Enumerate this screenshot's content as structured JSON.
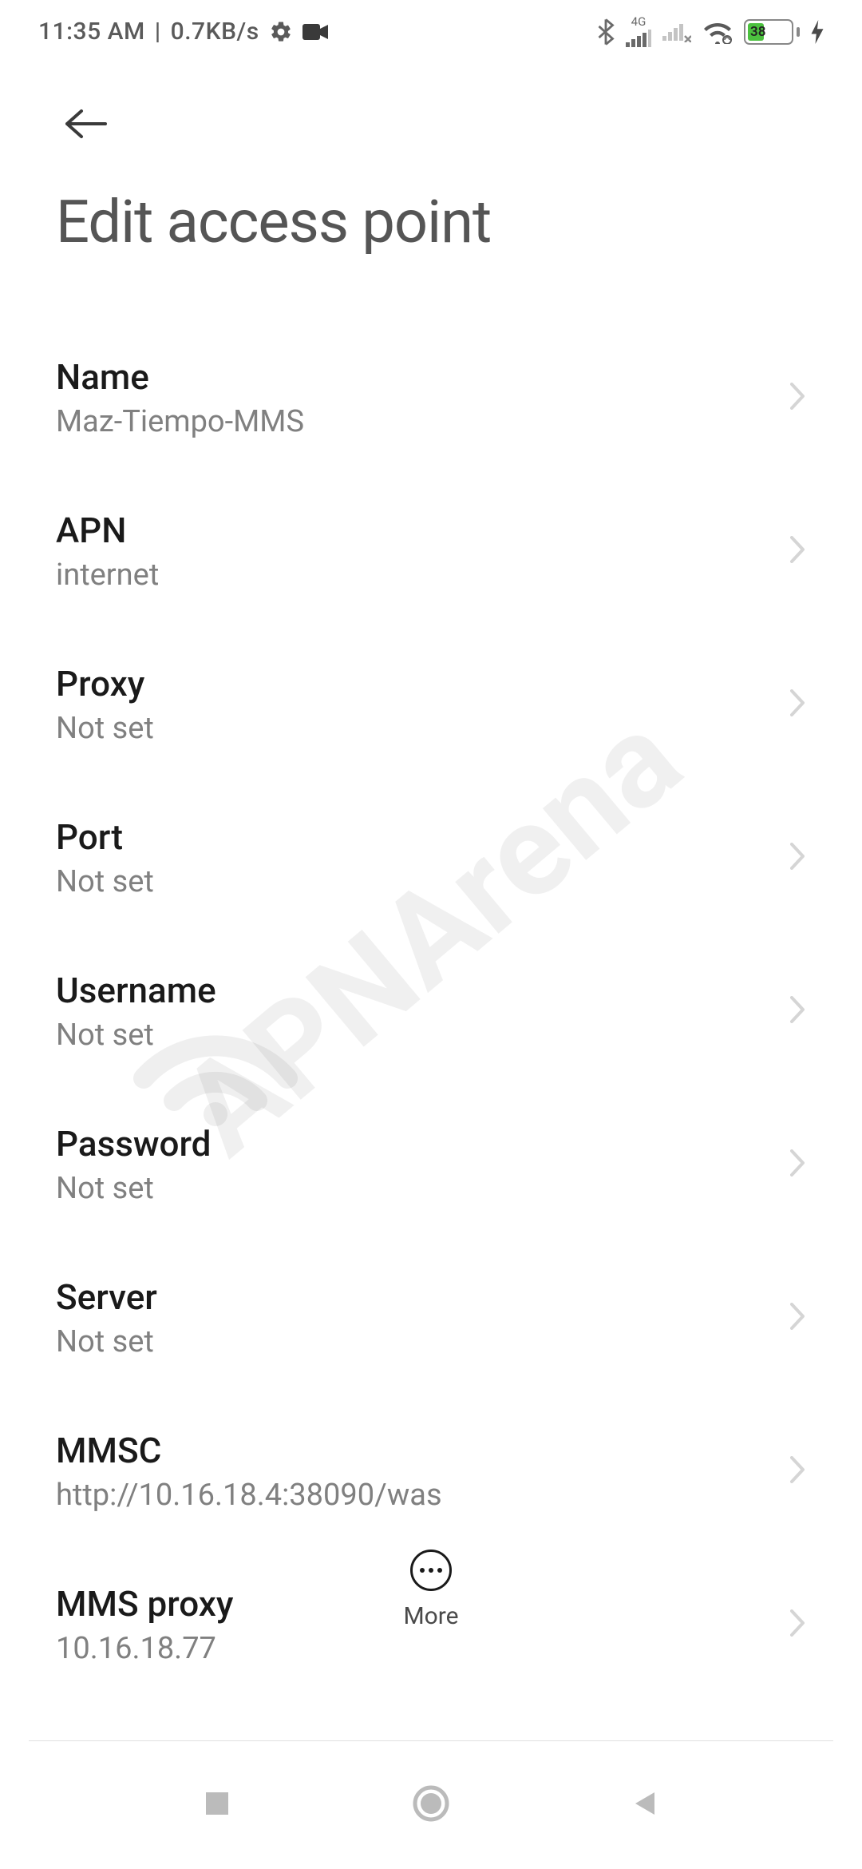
{
  "status": {
    "time": "11:35 AM",
    "sep": "|",
    "speed": "0.7KB/s",
    "network_label": "4G",
    "battery_pct": "38"
  },
  "header": {
    "title": "Edit access point"
  },
  "rows": [
    {
      "label": "Name",
      "value": "Maz-Tiempo-MMS"
    },
    {
      "label": "APN",
      "value": "internet"
    },
    {
      "label": "Proxy",
      "value": "Not set"
    },
    {
      "label": "Port",
      "value": "Not set"
    },
    {
      "label": "Username",
      "value": "Not set"
    },
    {
      "label": "Password",
      "value": "Not set"
    },
    {
      "label": "Server",
      "value": "Not set"
    },
    {
      "label": "MMSC",
      "value": "http://10.16.18.4:38090/was"
    },
    {
      "label": "MMS proxy",
      "value": "10.16.18.77"
    }
  ],
  "footer": {
    "more_label": "More"
  },
  "watermark": "APNArena"
}
